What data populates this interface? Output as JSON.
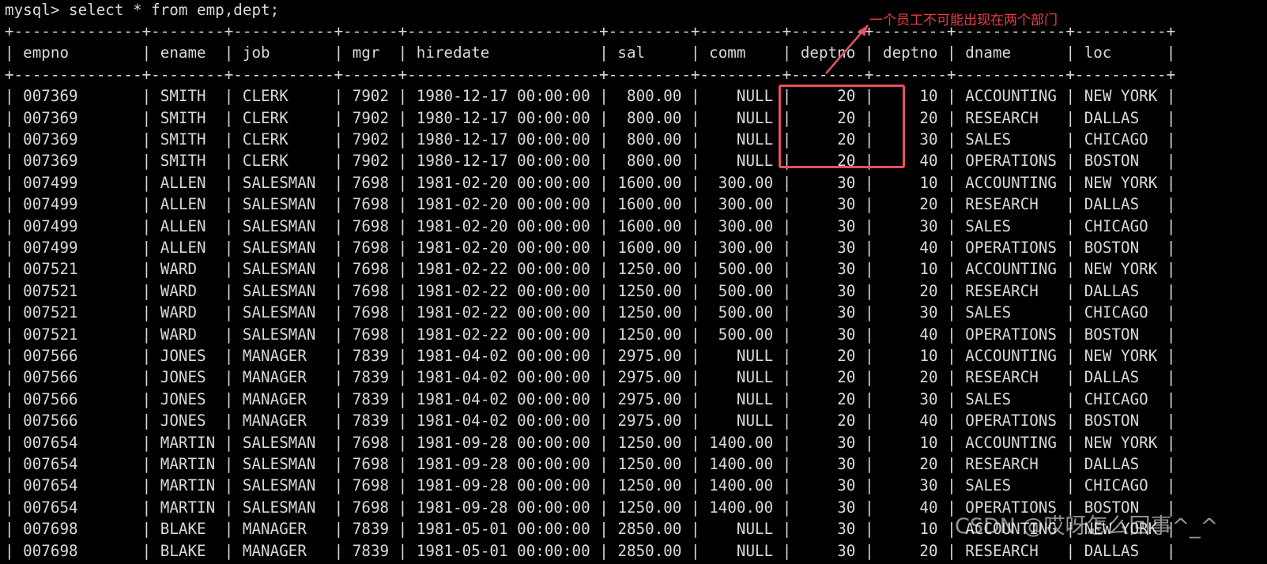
{
  "prompt": "mysql> select * from emp,dept;",
  "columns": [
    {
      "name": "empno",
      "width": 12,
      "align": "left"
    },
    {
      "name": "ename",
      "width": 6,
      "align": "left"
    },
    {
      "name": "job",
      "width": 9,
      "align": "left"
    },
    {
      "name": "mgr",
      "width": 4,
      "align": "left"
    },
    {
      "name": "hiredate",
      "width": 19,
      "align": "left"
    },
    {
      "name": "sal",
      "width": 7,
      "align": "right"
    },
    {
      "name": "comm",
      "width": 7,
      "align": "right"
    },
    {
      "name": "deptno",
      "width": 6,
      "align": "right"
    },
    {
      "name": "deptno",
      "width": 6,
      "align": "right"
    },
    {
      "name": "dname",
      "width": 10,
      "align": "left"
    },
    {
      "name": "loc",
      "width": 8,
      "align": "left"
    }
  ],
  "rows": [
    [
      "007369",
      "SMITH",
      "CLERK",
      "7902",
      "1980-12-17 00:00:00",
      "800.00",
      "NULL",
      "20",
      "10",
      "ACCOUNTING",
      "NEW YORK"
    ],
    [
      "007369",
      "SMITH",
      "CLERK",
      "7902",
      "1980-12-17 00:00:00",
      "800.00",
      "NULL",
      "20",
      "20",
      "RESEARCH",
      "DALLAS"
    ],
    [
      "007369",
      "SMITH",
      "CLERK",
      "7902",
      "1980-12-17 00:00:00",
      "800.00",
      "NULL",
      "20",
      "30",
      "SALES",
      "CHICAGO"
    ],
    [
      "007369",
      "SMITH",
      "CLERK",
      "7902",
      "1980-12-17 00:00:00",
      "800.00",
      "NULL",
      "20",
      "40",
      "OPERATIONS",
      "BOSTON"
    ],
    [
      "007499",
      "ALLEN",
      "SALESMAN",
      "7698",
      "1981-02-20 00:00:00",
      "1600.00",
      "300.00",
      "30",
      "10",
      "ACCOUNTING",
      "NEW YORK"
    ],
    [
      "007499",
      "ALLEN",
      "SALESMAN",
      "7698",
      "1981-02-20 00:00:00",
      "1600.00",
      "300.00",
      "30",
      "20",
      "RESEARCH",
      "DALLAS"
    ],
    [
      "007499",
      "ALLEN",
      "SALESMAN",
      "7698",
      "1981-02-20 00:00:00",
      "1600.00",
      "300.00",
      "30",
      "30",
      "SALES",
      "CHICAGO"
    ],
    [
      "007499",
      "ALLEN",
      "SALESMAN",
      "7698",
      "1981-02-20 00:00:00",
      "1600.00",
      "300.00",
      "30",
      "40",
      "OPERATIONS",
      "BOSTON"
    ],
    [
      "007521",
      "WARD",
      "SALESMAN",
      "7698",
      "1981-02-22 00:00:00",
      "1250.00",
      "500.00",
      "30",
      "10",
      "ACCOUNTING",
      "NEW YORK"
    ],
    [
      "007521",
      "WARD",
      "SALESMAN",
      "7698",
      "1981-02-22 00:00:00",
      "1250.00",
      "500.00",
      "30",
      "20",
      "RESEARCH",
      "DALLAS"
    ],
    [
      "007521",
      "WARD",
      "SALESMAN",
      "7698",
      "1981-02-22 00:00:00",
      "1250.00",
      "500.00",
      "30",
      "30",
      "SALES",
      "CHICAGO"
    ],
    [
      "007521",
      "WARD",
      "SALESMAN",
      "7698",
      "1981-02-22 00:00:00",
      "1250.00",
      "500.00",
      "30",
      "40",
      "OPERATIONS",
      "BOSTON"
    ],
    [
      "007566",
      "JONES",
      "MANAGER",
      "7839",
      "1981-04-02 00:00:00",
      "2975.00",
      "NULL",
      "20",
      "10",
      "ACCOUNTING",
      "NEW YORK"
    ],
    [
      "007566",
      "JONES",
      "MANAGER",
      "7839",
      "1981-04-02 00:00:00",
      "2975.00",
      "NULL",
      "20",
      "20",
      "RESEARCH",
      "DALLAS"
    ],
    [
      "007566",
      "JONES",
      "MANAGER",
      "7839",
      "1981-04-02 00:00:00",
      "2975.00",
      "NULL",
      "20",
      "30",
      "SALES",
      "CHICAGO"
    ],
    [
      "007566",
      "JONES",
      "MANAGER",
      "7839",
      "1981-04-02 00:00:00",
      "2975.00",
      "NULL",
      "20",
      "40",
      "OPERATIONS",
      "BOSTON"
    ],
    [
      "007654",
      "MARTIN",
      "SALESMAN",
      "7698",
      "1981-09-28 00:00:00",
      "1250.00",
      "1400.00",
      "30",
      "10",
      "ACCOUNTING",
      "NEW YORK"
    ],
    [
      "007654",
      "MARTIN",
      "SALESMAN",
      "7698",
      "1981-09-28 00:00:00",
      "1250.00",
      "1400.00",
      "30",
      "20",
      "RESEARCH",
      "DALLAS"
    ],
    [
      "007654",
      "MARTIN",
      "SALESMAN",
      "7698",
      "1981-09-28 00:00:00",
      "1250.00",
      "1400.00",
      "30",
      "30",
      "SALES",
      "CHICAGO"
    ],
    [
      "007654",
      "MARTIN",
      "SALESMAN",
      "7698",
      "1981-09-28 00:00:00",
      "1250.00",
      "1400.00",
      "30",
      "40",
      "OPERATIONS",
      "BOSTON"
    ],
    [
      "007698",
      "BLAKE",
      "MANAGER",
      "7839",
      "1981-05-01 00:00:00",
      "2850.00",
      "NULL",
      "30",
      "10",
      "ACCOUNTING",
      "NEW YORK"
    ],
    [
      "007698",
      "BLAKE",
      "MANAGER",
      "7839",
      "1981-05-01 00:00:00",
      "2850.00",
      "NULL",
      "30",
      "20",
      "RESEARCH",
      "DALLAS"
    ]
  ],
  "annotation": {
    "text": "一个员工不可能出现在两个部门",
    "color": "#ee3a45",
    "box_color": "#e8505e"
  },
  "watermark": "CSDN @哎呀怎么回事^_^",
  "colors": {
    "background": "#000000",
    "text": "#d9d9d9"
  }
}
